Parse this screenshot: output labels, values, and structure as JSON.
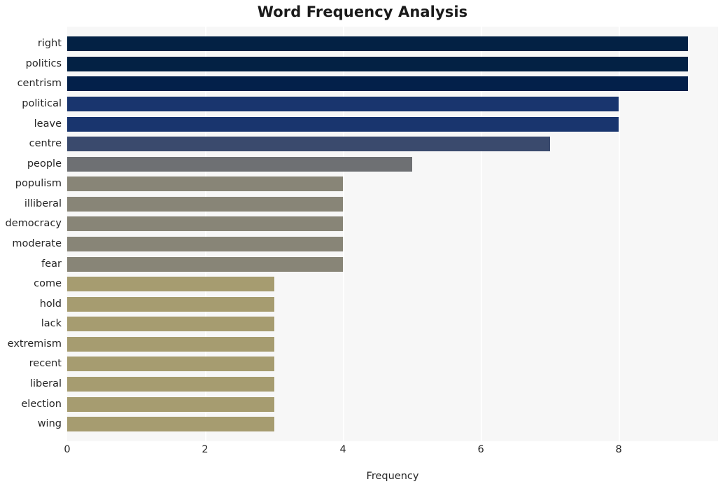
{
  "chart_data": {
    "type": "bar",
    "orientation": "horizontal",
    "title": "Word Frequency Analysis",
    "xlabel": "Frequency",
    "ylabel": "",
    "categories": [
      "right",
      "politics",
      "centrism",
      "political",
      "leave",
      "centre",
      "people",
      "populism",
      "illiberal",
      "democracy",
      "moderate",
      "fear",
      "come",
      "hold",
      "lack",
      "extremism",
      "recent",
      "liberal",
      "election",
      "wing"
    ],
    "values": [
      9,
      9,
      9,
      8,
      8,
      7,
      5,
      4,
      4,
      4,
      4,
      4,
      3,
      3,
      3,
      3,
      3,
      3,
      3,
      3
    ],
    "bar_colors": [
      "#032144",
      "#032144",
      "#03204a",
      "#19356e",
      "#19356e",
      "#3a4a6d",
      "#6e7073",
      "#888577",
      "#888577",
      "#888577",
      "#888577",
      "#888577",
      "#a69c70",
      "#a69c70",
      "#a69c70",
      "#a69c70",
      "#a69c70",
      "#a69c70",
      "#a69c70",
      "#a69c70"
    ],
    "xlim": [
      0,
      9.44
    ],
    "xticks": [
      0,
      2,
      4,
      6,
      8
    ],
    "xtick_labels": [
      "0",
      "2",
      "4",
      "6",
      "8"
    ],
    "grid": "vertical-only",
    "legend": "none",
    "plot_background": "#f7f7f7",
    "figure_background": "#ffffff"
  }
}
